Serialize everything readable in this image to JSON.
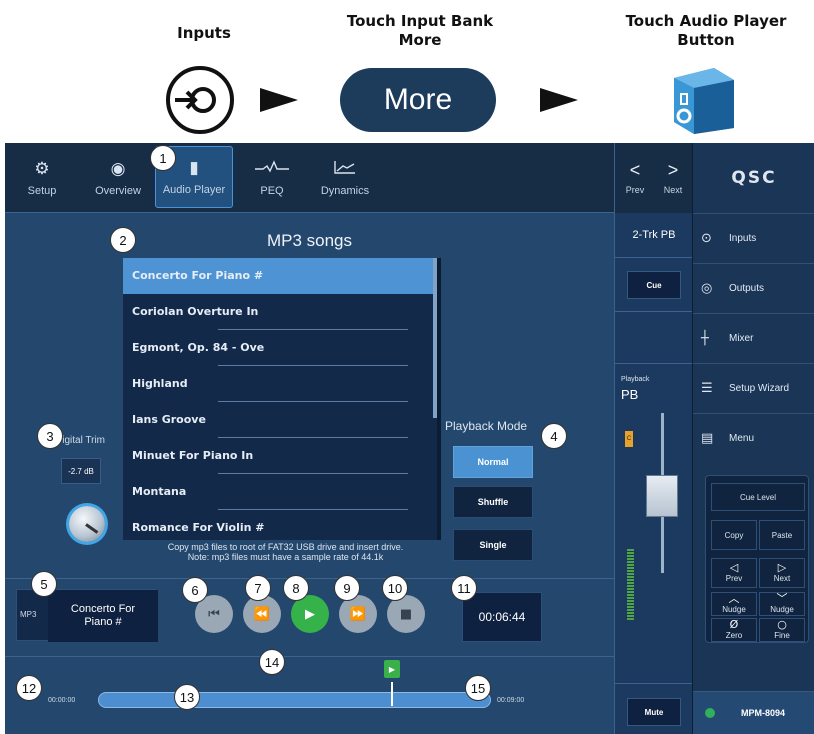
{
  "instructions": {
    "step1": "Inputs",
    "step2": "Touch Input Bank\nMore",
    "step3": "Touch Audio Player\nButton",
    "more_button": "More"
  },
  "tabs": [
    {
      "label": "Setup",
      "icon": "gear-icon"
    },
    {
      "label": "Overview",
      "icon": "eye-icon"
    },
    {
      "label": "Audio Player",
      "icon": "speaker-box-icon",
      "active": true
    },
    {
      "label": "PEQ",
      "icon": "eq-curve-icon"
    },
    {
      "label": "Dynamics",
      "icon": "dynamics-icon"
    }
  ],
  "player": {
    "title": "MP3 songs",
    "songs": [
      "Concerto For Piano #",
      "Coriolan Overture In",
      "Egmont, Op. 84 - Ove",
      "Highland",
      "Ians Groove",
      "Minuet For Piano In",
      "Montana",
      "Romance For Violin #"
    ],
    "selected_index": 0,
    "note_line1": "Copy mp3 files to root of FAT32 USB drive and insert drive.",
    "note_line2": "Note: mp3 files must have a sample rate of 44.1k",
    "digital_trim_label": "Digital Trim",
    "digital_trim_value": "-2.7 dB",
    "playback_mode_label": "Playback Mode",
    "playback_modes": [
      "Normal",
      "Shuffle",
      "Single"
    ],
    "playback_mode_selected": "Normal",
    "track_type": "MP3",
    "track_name": "Concerto For\nPiano #",
    "elapsed": "00:06:44",
    "time_start": "00:00:00",
    "time_end": "00:09:00",
    "progress_fraction": 0.748
  },
  "channel": {
    "prev_label": "Prev",
    "next_label": "Next",
    "name": "2-Trk PB",
    "cue_label": "Cue",
    "playback_label": "Playback",
    "playback_short": "PB",
    "clip_label": "C",
    "mute_label": "Mute"
  },
  "sidebar": {
    "logo": "QSC",
    "items": [
      {
        "label": "Inputs",
        "icon": "input-icon"
      },
      {
        "label": "Outputs",
        "icon": "output-icon"
      },
      {
        "label": "Mixer",
        "icon": "mixer-icon"
      },
      {
        "label": "Setup Wizard",
        "icon": "wizard-icon"
      },
      {
        "label": "Menu",
        "icon": "menu-icon"
      }
    ],
    "cue_level": "Cue Level",
    "copy": "Copy",
    "paste": "Paste",
    "prev": "Prev",
    "next": "Next",
    "nudge": "Nudge",
    "zero": "Zero",
    "fine": "Fine",
    "device": "MPM-8094"
  },
  "callouts": [
    "1",
    "2",
    "3",
    "4",
    "5",
    "6",
    "7",
    "8",
    "9",
    "10",
    "11",
    "12",
    "13",
    "14",
    "15"
  ]
}
